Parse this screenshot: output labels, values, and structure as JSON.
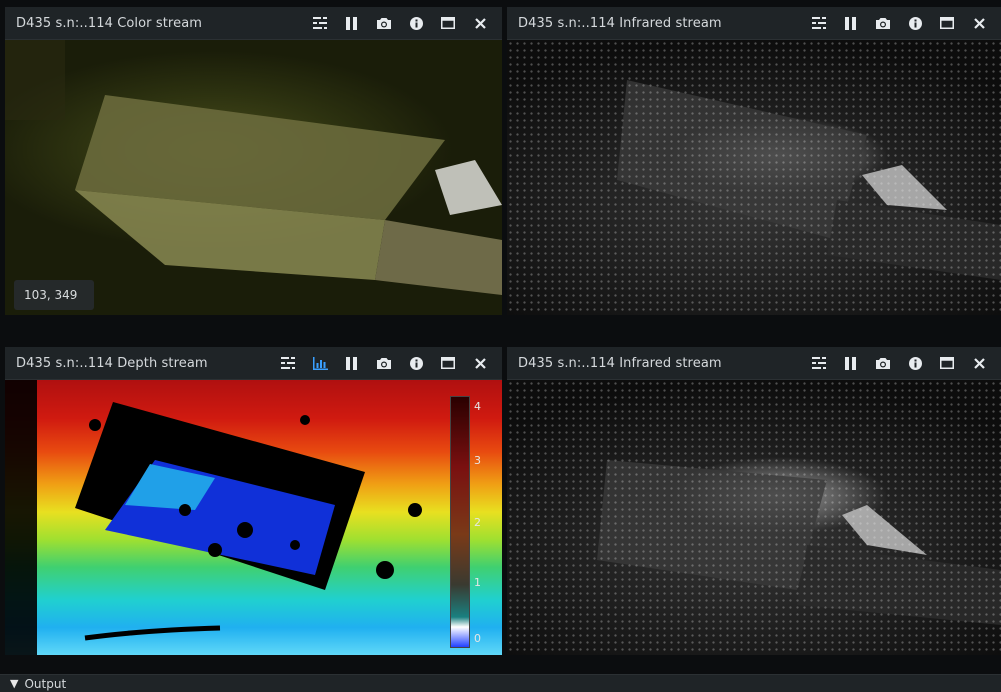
{
  "panels": {
    "color": {
      "title": "D435 s.n:..114 Color stream",
      "readout": "103, 349"
    },
    "ir_top": {
      "title": "D435 s.n:..114 Infrared stream"
    },
    "depth": {
      "title": "D435 s.n:..114 Depth stream",
      "colorbar_labels": [
        "4",
        "3",
        "2",
        "1",
        "0"
      ]
    },
    "ir_bottom": {
      "title": "D435 s.n:..114 Infrared stream"
    }
  },
  "icons": {
    "options": "options-icon",
    "metadata": "metadata-chart-icon",
    "pause": "pause-icon",
    "snapshot": "camera-icon",
    "info": "info-icon",
    "maximize": "maximize-icon",
    "close": "close-icon"
  },
  "colors": {
    "icon": "#e8ecef",
    "icon_active": "#3aa0ff",
    "titlebar": "#1f2427"
  },
  "output": {
    "label": "Output"
  }
}
